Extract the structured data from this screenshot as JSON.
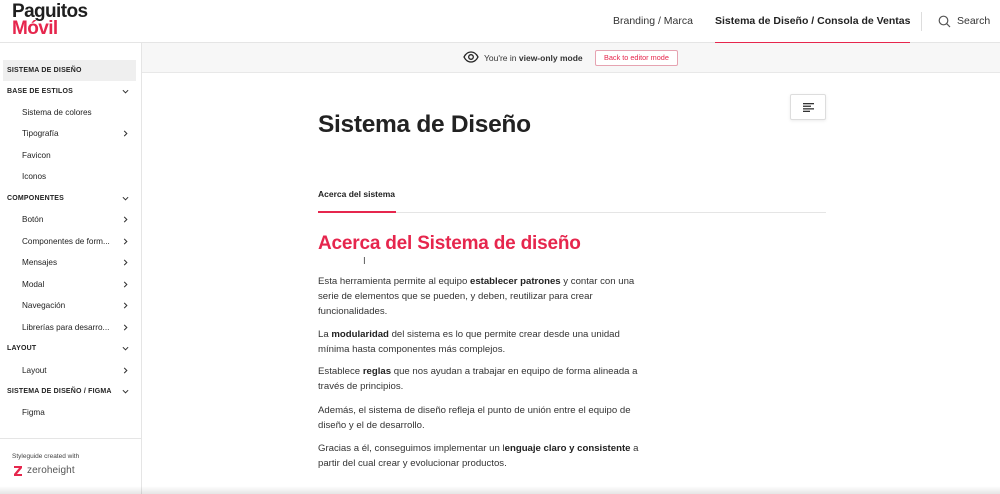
{
  "logo": {
    "line1": "Paguitos",
    "line2": "Móvil"
  },
  "nav": [
    {
      "label": "Branding / Marca"
    },
    {
      "label": "Sistema de Diseño / Consola de Ventas"
    }
  ],
  "search": {
    "label": "Search"
  },
  "viewbar": {
    "prefix": "You're in ",
    "mode": "view-only mode",
    "button": "Back to editor mode"
  },
  "sidebar": {
    "items": [
      {
        "label": "SISTEMA DE DISEÑO"
      },
      {
        "label": "BASE DE ESTILOS"
      },
      {
        "label": "Sistema de colores"
      },
      {
        "label": "Tipografía"
      },
      {
        "label": "Favicon"
      },
      {
        "label": "Iconos"
      },
      {
        "label": "COMPONENTES"
      },
      {
        "label": "Botón"
      },
      {
        "label": "Componentes de form..."
      },
      {
        "label": "Mensajes"
      },
      {
        "label": "Modal"
      },
      {
        "label": "Navegación"
      },
      {
        "label": "Librerías para desarro..."
      },
      {
        "label": "LAYOUT"
      },
      {
        "label": "Layout"
      },
      {
        "label": "SISTEMA DE DISEÑO / FIGMA"
      },
      {
        "label": "Figma"
      }
    ],
    "footer": {
      "caption": "Styleguide created with",
      "brand": "zeroheight"
    }
  },
  "content": {
    "title": "Sistema de Diseño",
    "tab": "Acerca del sistema",
    "heading": "Acerca del Sistema de diseño",
    "paragraphs": [
      {
        "a": "Esta herramienta permite al equipo ",
        "b": "establecer patrones",
        "c": " y contar con una serie de elementos que se pueden, y deben, reutilizar para crear funcionalidades."
      },
      {
        "a": "La ",
        "b": "modularidad",
        "c": " del sistema es lo que permite crear desde una unidad mínima hasta componentes más complejos."
      },
      {
        "a": "Establece ",
        "b": "reglas",
        "c": " que nos ayudan a trabajar en equipo de forma alineada a través de principios."
      },
      {
        "a": "Además, el sistema de diseño refleja el punto de unión entre el equipo de diseño y el de desarrollo.",
        "b": "",
        "c": ""
      },
      {
        "a": "Gracias a él, conseguimos implementar un l",
        "b": "enguaje claro y consistente",
        "c": " a partir del cual crear y evolucionar productos."
      }
    ]
  },
  "colors": {
    "accent": "#e6264d",
    "text": "#222222",
    "border": "#e5e5e5"
  }
}
